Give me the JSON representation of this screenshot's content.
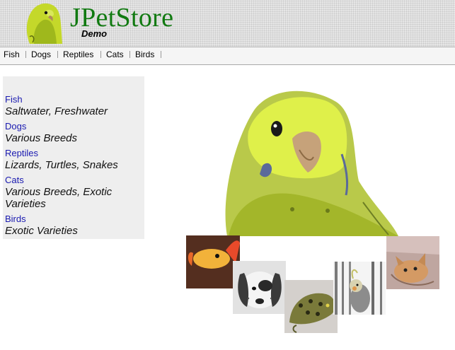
{
  "header": {
    "logo_title": "JPetStore",
    "logo_subtitle": "Demo",
    "colors": {
      "title": "#117a11",
      "bird": "#c4d82a"
    }
  },
  "menu": {
    "items": [
      {
        "label": "Fish"
      },
      {
        "label": "Dogs"
      },
      {
        "label": "Reptiles"
      },
      {
        "label": "Cats"
      },
      {
        "label": "Birds"
      }
    ]
  },
  "sidebar": {
    "categories": [
      {
        "label": "Fish",
        "description": "Saltwater, Freshwater"
      },
      {
        "label": "Dogs",
        "description": "Various Breeds"
      },
      {
        "label": "Reptiles",
        "description": "Lizards, Turtles, Snakes"
      },
      {
        "label": "Cats",
        "description": "Various Breeds, Exotic Varieties"
      },
      {
        "label": "Birds",
        "description": "Exotic Varieties"
      }
    ]
  },
  "splash": {
    "images": [
      "parakeet",
      "fish",
      "dog",
      "reptile",
      "cockatiel",
      "cat"
    ]
  }
}
